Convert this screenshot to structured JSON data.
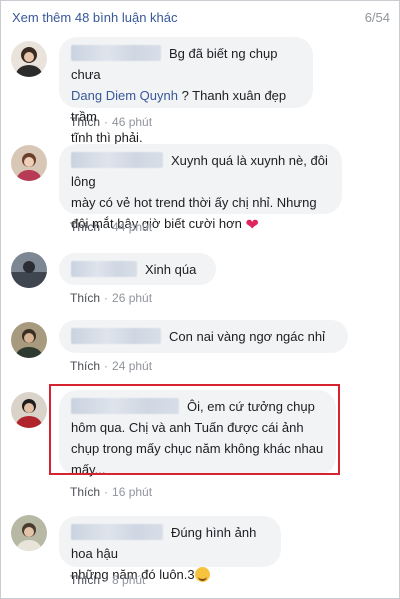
{
  "header": {
    "more_comments": "Xem thêm 48 bình luận khác",
    "pager": "6/54"
  },
  "comments": [
    {
      "line1": "Bg đã biết ng chụp chưa",
      "mention": "Dang Diem Quynh",
      "line2_rest": " ? Thanh xuân đẹp trầm",
      "line3": "tĩnh thì phải.",
      "like": "Thích",
      "time": "46 phút"
    },
    {
      "line1": "Xuynh quá là xuynh nè, đôi lông",
      "line2": "mày có vẻ hot trend thời ấy chị nhỉ. Nhưng",
      "line3": "đôi mắt bây giờ biết cười hơn",
      "emoji": "red-heart",
      "like": "Thích",
      "time": "44 phút"
    },
    {
      "line1": "Xinh qúa",
      "like": "Thích",
      "time": "26 phút"
    },
    {
      "line1": "Con nai vàng ngơ ngác nhỉ",
      "like": "Thích",
      "time": "24 phút"
    },
    {
      "line1": "Ôi, em cứ tưởng chụp",
      "line2": "hôm qua. Chị và anh Tuấn được cái ảnh",
      "line3": "chụp trong mấy chục năm không khác nhau",
      "line4": "mấy...",
      "like": "Thích",
      "time": "16 phút"
    },
    {
      "line1": "Đúng hình ảnh hoa hậu",
      "line2": "những năm đó luôn.3",
      "emoji": "smiling-face-with-hearts",
      "like": "Thích",
      "time": "8 phút"
    }
  ],
  "colors": {
    "link": "#385898",
    "bubble": "#f2f3f5",
    "meta": "#90949c",
    "highlight_border": "#d6232f"
  }
}
